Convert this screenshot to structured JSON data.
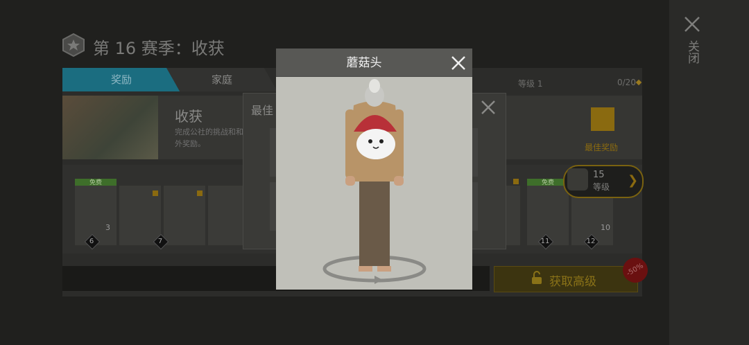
{
  "season": {
    "title": "第 16 赛季：收获"
  },
  "close": {
    "label": "关闭"
  },
  "tabs": [
    {
      "label": "奖励"
    },
    {
      "label": "家庭"
    }
  ],
  "level": {
    "label": "等级 1",
    "progress": "0/20"
  },
  "banner": {
    "title": "收获",
    "desc": "完成公社的挑战和和额外奖励。"
  },
  "best_reward": {
    "label": "最佳奖励"
  },
  "tiers": [
    {
      "level": "6",
      "free": "免费",
      "count": "3"
    },
    {
      "level": "7"
    },
    {
      "level": "11",
      "free": "免费"
    },
    {
      "level": "12",
      "count": "10"
    }
  ],
  "level_pill": {
    "value": "15",
    "label": "等级"
  },
  "premium_button": {
    "label": "获取高级"
  },
  "discount_badge": {
    "text": "-50%"
  },
  "back_dialog": {
    "title": "最佳"
  },
  "dialog": {
    "title": "蘑菇头"
  }
}
